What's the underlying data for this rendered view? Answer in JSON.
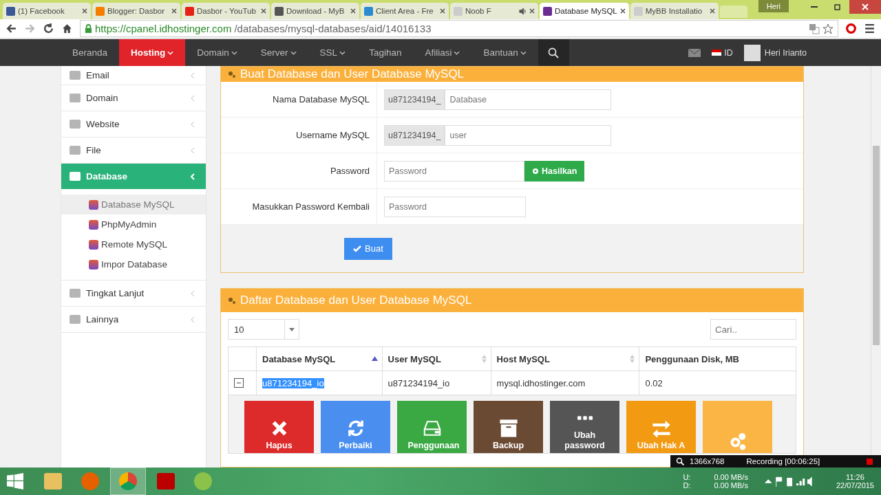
{
  "browser": {
    "tabs": [
      {
        "title": "(1) Facebook",
        "selected": false,
        "audio": false
      },
      {
        "title": "Blogger: Dasbor",
        "selected": false,
        "audio": false
      },
      {
        "title": "Dasbor - YouTub",
        "selected": false,
        "audio": false
      },
      {
        "title": "Download - MyB",
        "selected": false,
        "audio": false
      },
      {
        "title": "Client Area - Fre",
        "selected": false,
        "audio": false
      },
      {
        "title": "Noob F",
        "selected": false,
        "audio": true
      },
      {
        "title": "Database MySQL",
        "selected": true,
        "audio": false
      },
      {
        "title": "MyBB Installatio",
        "selected": false,
        "audio": false
      }
    ],
    "profile": "Heri",
    "url": {
      "host": "https://cpanel.idhostinger.com",
      "path": "/databases/mysql-databases/aid/14016133"
    }
  },
  "nav": {
    "items": [
      {
        "label": "Beranda",
        "selected": false,
        "dropdown": false
      },
      {
        "label": "Hosting",
        "selected": true,
        "dropdown": true
      },
      {
        "label": "Domain",
        "selected": false,
        "dropdown": true
      },
      {
        "label": "Server",
        "selected": false,
        "dropdown": true
      },
      {
        "label": "SSL",
        "selected": false,
        "dropdown": true
      },
      {
        "label": "Tagihan",
        "selected": false,
        "dropdown": false
      },
      {
        "label": "Afiliasi",
        "selected": false,
        "dropdown": true
      },
      {
        "label": "Bantuan",
        "selected": false,
        "dropdown": true
      }
    ],
    "language": "ID",
    "user": "Heri Irianto"
  },
  "sidebar": {
    "items": [
      {
        "label": "Email",
        "selected": false,
        "expanded": false
      },
      {
        "label": "Domain",
        "selected": false,
        "expanded": false
      },
      {
        "label": "Website",
        "selected": false,
        "expanded": false
      },
      {
        "label": "File",
        "selected": false,
        "expanded": false
      },
      {
        "label": "Database",
        "selected": true,
        "expanded": true,
        "children": [
          {
            "label": "Database MySQL",
            "selected": true
          },
          {
            "label": "PhpMyAdmin",
            "selected": false
          },
          {
            "label": "Remote MySQL",
            "selected": false
          },
          {
            "label": "Impor Database",
            "selected": false
          }
        ]
      },
      {
        "label": "Tingkat Lanjut",
        "selected": false,
        "expanded": false
      },
      {
        "label": "Lainnya",
        "selected": false,
        "expanded": false
      }
    ]
  },
  "form_panel": {
    "title": "Buat Database dan User Database MySQL",
    "fields": [
      {
        "kind": "prefixed",
        "label": "Nama Database MySQL",
        "prefix": "u871234194_",
        "placeholder": "Database"
      },
      {
        "kind": "prefixed",
        "label": "Username MySQL",
        "prefix": "u871234194_",
        "placeholder": "user"
      },
      {
        "kind": "generate",
        "label": "Password",
        "placeholder": "Password",
        "button": "Hasilkan"
      },
      {
        "kind": "plain",
        "label": "Masukkan Password Kembali",
        "placeholder": "Password"
      }
    ],
    "submit": "Buat"
  },
  "list_panel": {
    "title": "Daftar Database dan User Database MySQL",
    "page_size": "10",
    "search_placeholder": "Cari..",
    "columns": [
      {
        "label": "Database MySQL",
        "sortable": true,
        "sorted": true
      },
      {
        "label": "User MySQL",
        "sortable": true,
        "sorted": false
      },
      {
        "label": "Host MySQL",
        "sortable": true,
        "sorted": false
      },
      {
        "label": "Penggunaan Disk, MB",
        "sortable": false,
        "sorted": false
      }
    ],
    "rows": [
      {
        "expanded": true,
        "cells": [
          "u871234194_io",
          "u871234194_io",
          "mysql.idhostinger.com",
          "0.02"
        ],
        "name_selected": true
      }
    ],
    "actions": [
      {
        "kind": "delete",
        "label": "Hapus",
        "color": "#dd2a2a"
      },
      {
        "kind": "repair",
        "label": "Perbaiki",
        "color": "#4a8ef0"
      },
      {
        "kind": "usage",
        "label": "Penggunaan",
        "color": "#3aa843"
      },
      {
        "kind": "backup",
        "label": "Backup",
        "color": "#6b4a33"
      },
      {
        "kind": "password",
        "label": "Ubah password",
        "color": "#555555"
      },
      {
        "kind": "access",
        "label": "Ubah Hak A",
        "color": "#f29a12"
      },
      {
        "kind": "settings",
        "color": "#fbb545"
      }
    ]
  },
  "recorder": {
    "resolution": "1366x768",
    "status": "Recording [00:06:25]"
  },
  "taskbar": {
    "net": [
      {
        "label": "U:",
        "value": "0.00 MB/s"
      },
      {
        "label": "D:",
        "value": "0.00 MB/s"
      }
    ],
    "time": "11:26",
    "date": "22/07/2015"
  }
}
